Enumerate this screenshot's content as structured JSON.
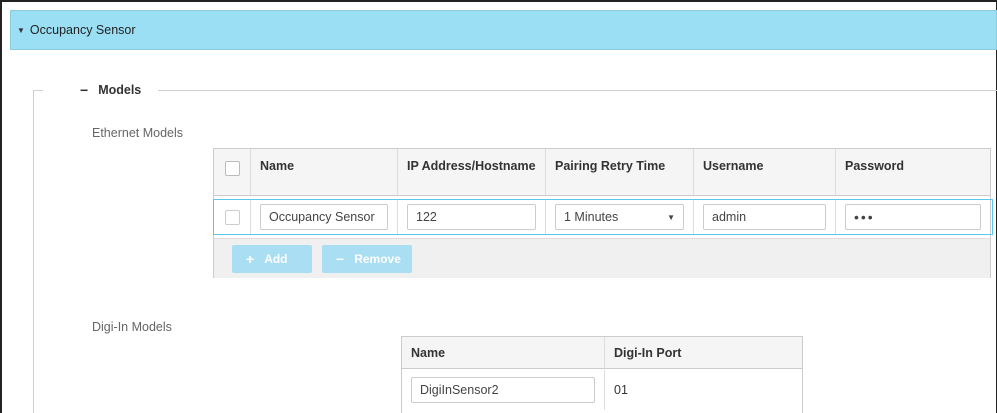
{
  "panel": {
    "title": "Occupancy Sensor",
    "caret": "▼"
  },
  "models": {
    "legend": "Models",
    "collapse_symbol": "−"
  },
  "ethernet": {
    "label": "Ethernet Models",
    "columns": [
      "Name",
      "IP Address/Hostname",
      "Pairing Retry Time",
      "Username",
      "Password"
    ],
    "rows": [
      {
        "name": "Occupancy Sensor",
        "ip": "122",
        "retry": "1 Minutes",
        "username": "admin",
        "password": "•••"
      }
    ],
    "add_label": "Add",
    "remove_label": "Remove",
    "add_symbol": "+",
    "remove_symbol": "−"
  },
  "digi": {
    "label": "Digi-In Models",
    "columns": [
      "Name",
      "Digi-In Port"
    ],
    "rows": [
      {
        "name": "DigiInSensor2",
        "port": "01"
      }
    ]
  },
  "colors": {
    "header_bg": "#9bdff5",
    "button_bg": "#a9def3",
    "row_highlight": "#5cc6eb"
  },
  "icons": {
    "caret": "caret-down-icon",
    "select_arrow": "chevron-down-icon"
  }
}
